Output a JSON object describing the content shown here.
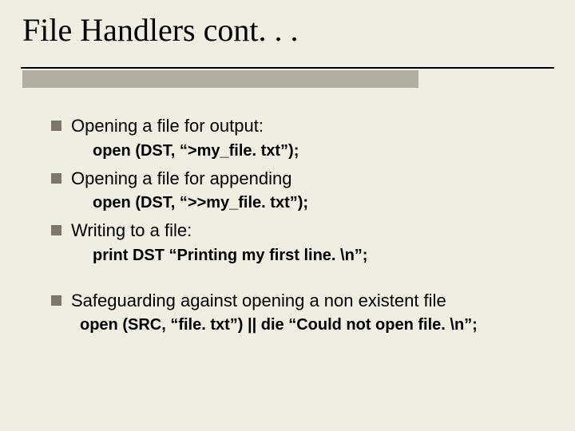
{
  "title": "File Handlers cont. . .",
  "items": [
    {
      "text": "Opening a file for output:",
      "code": "open (DST, “>my_file. txt”);"
    },
    {
      "text": "Opening a file for appending",
      "code": "open (DST, “>>my_file. txt”);"
    },
    {
      "text": "Writing to a file:",
      "code": "print DST “Printing my first line. \\n”;"
    },
    {
      "text": "Safeguarding against opening a non existent file",
      "code": "open (SRC, “file. txt”) || die “Could not open file. \\n”;"
    }
  ]
}
